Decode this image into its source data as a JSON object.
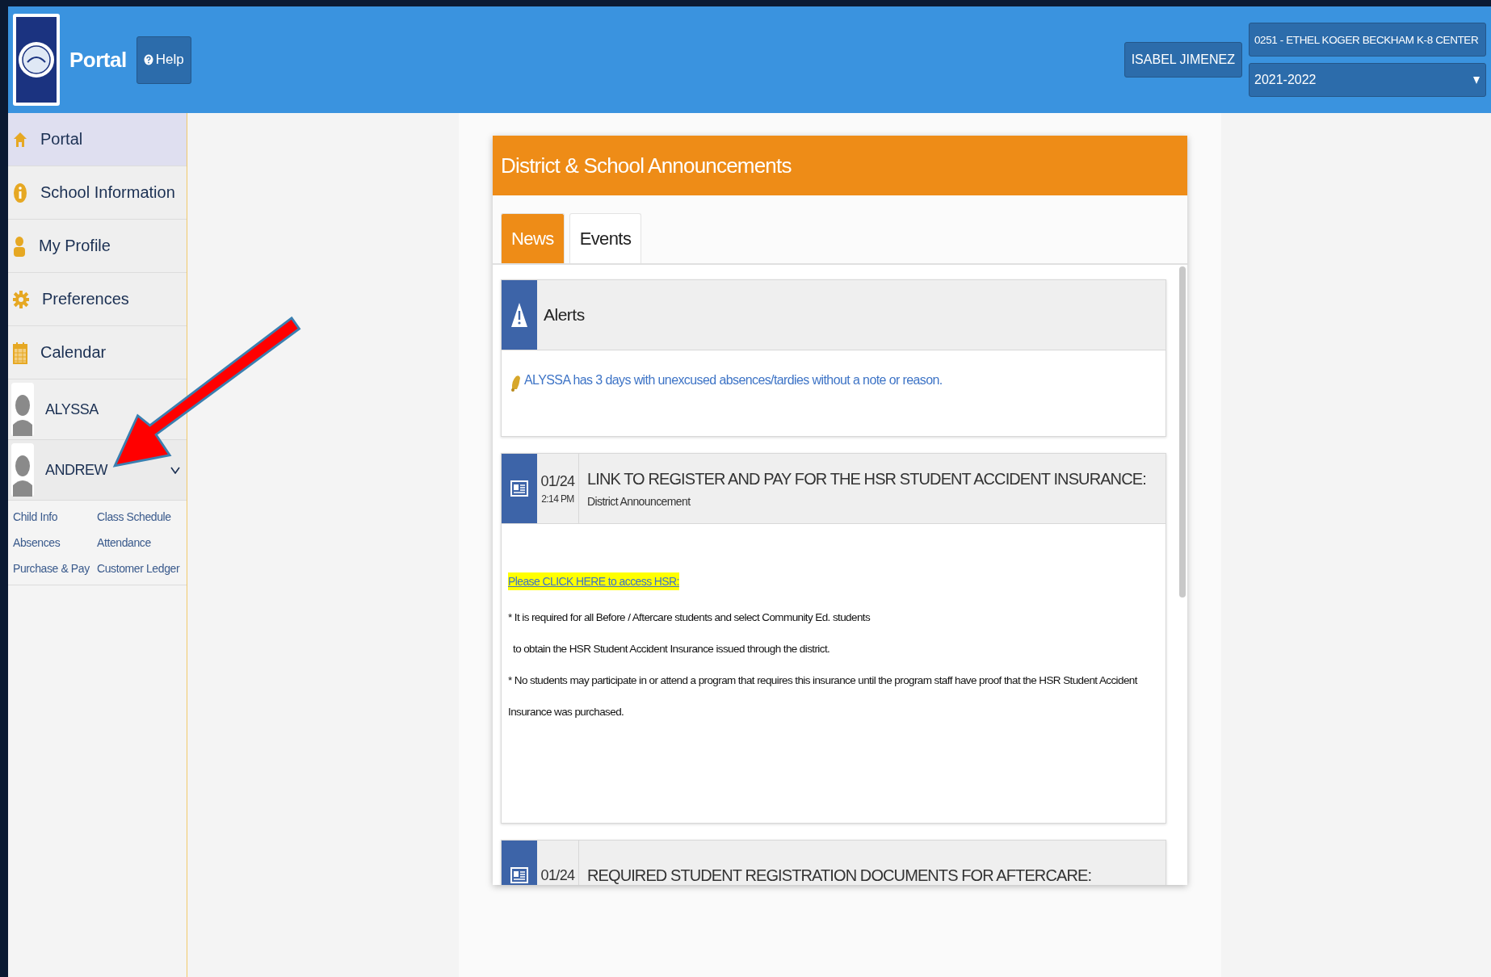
{
  "header": {
    "title": "Portal",
    "help": "Help",
    "user": "ISABEL JIMENEZ",
    "school": "0251 - ETHEL KOGER BECKHAM K-8 CENTER",
    "year": "2021-2022"
  },
  "sidebar": {
    "items": [
      {
        "label": "Portal",
        "selected": true
      },
      {
        "label": "School Information",
        "selected": false
      },
      {
        "label": "My Profile",
        "selected": false
      },
      {
        "label": "Preferences",
        "selected": false
      },
      {
        "label": "Calendar",
        "selected": false
      }
    ],
    "students": [
      {
        "name": "ALYSSA",
        "expanded": false
      },
      {
        "name": "ANDREW",
        "expanded": true,
        "links": [
          "Child Info",
          "Class Schedule",
          "Absences",
          "Attendance",
          "Purchase & Pay",
          "Customer Ledger"
        ]
      }
    ]
  },
  "announcements": {
    "title": "District & School Announcements",
    "tabs": [
      {
        "label": "News",
        "selected": true
      },
      {
        "label": "Events",
        "selected": false
      }
    ],
    "alerts": {
      "title": "Alerts",
      "items": [
        "ALYSSA has 3 days with unexcused absences/tardies without a note or reason."
      ]
    },
    "posts": [
      {
        "date": "01/24",
        "time": "2:14 PM",
        "title": "LINK TO REGISTER AND PAY FOR THE HSR STUDENT ACCIDENT INSURANCE:",
        "source": "District Announcement",
        "link": "Please CLICK HERE to access HSR:",
        "paragraphs": [
          "* It is required for all Before / Aftercare students and select Community Ed. students",
          "to obtain the HSR Student Accident Insurance issued through the district.",
          "* No students may participate in or attend a program that requires this insurance until the program staff have proof that the HSR Student Accident Insurance was purchased."
        ]
      },
      {
        "date": "01/24",
        "title": "REQUIRED STUDENT REGISTRATION DOCUMENTS FOR AFTERCARE:"
      }
    ]
  }
}
